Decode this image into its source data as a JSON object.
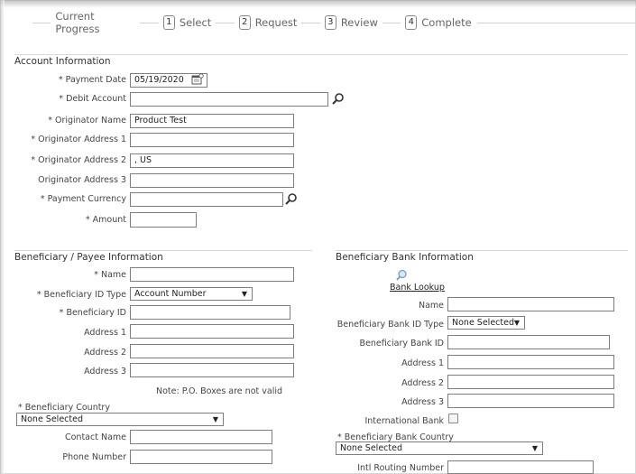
{
  "progress": {
    "title": "Current Progress",
    "steps": [
      {
        "num": "1",
        "label": "Select"
      },
      {
        "num": "2",
        "label": "Request"
      },
      {
        "num": "3",
        "label": "Review"
      },
      {
        "num": "4",
        "label": "Complete"
      }
    ]
  },
  "account": {
    "title": "Account Information",
    "payment_date_label": "Payment Date",
    "payment_date_value": "05/19/2020",
    "debit_account_label": "Debit Account",
    "debit_account_value": "",
    "originator_name_label": "Originator Name",
    "originator_name_value": "Product Test",
    "addr1_label": "Originator Address 1",
    "addr1_value": "",
    "addr2_label": "Originator Address 2",
    "addr2_value": ",  US",
    "addr3_label": "Originator Address 3",
    "addr3_value": "",
    "currency_label": "Payment Currency",
    "currency_value": "",
    "amount_label": "Amount",
    "amount_value": ""
  },
  "beneficiary": {
    "title": "Beneficiary / Payee Information",
    "name_label": "Name",
    "name_value": "",
    "id_type_label": "Beneficiary ID Type",
    "id_type_value": "Account Number",
    "id_label": "Beneficiary ID",
    "id_value": "",
    "addr1_label": "Address 1",
    "addr2_label": "Address 2",
    "addr3_label": "Address 3",
    "note": "Note: P.O. Boxes are not valid",
    "country_label": "Beneficiary Country",
    "country_value": "None Selected",
    "contact_label": "Contact Name",
    "phone_label": "Phone Number"
  },
  "bank": {
    "title": "Beneficiary Bank Information",
    "lookup_label": "Bank Lookup",
    "name_label": "Name",
    "id_type_label": "Beneficiary Bank ID Type",
    "id_type_value": "None Selected",
    "id_label": "Beneficiary Bank ID",
    "addr1_label": "Address 1",
    "addr2_label": "Address 2",
    "addr3_label": "Address 3",
    "intl_label": "International Bank",
    "country_label": "Beneficiary Bank Country",
    "country_value": "None Selected",
    "routing_label": "Intl Routing Number"
  },
  "required_mark": "*",
  "caret": "▼",
  "icons": {
    "calendar": "calendar-icon",
    "search": "search-icon"
  }
}
